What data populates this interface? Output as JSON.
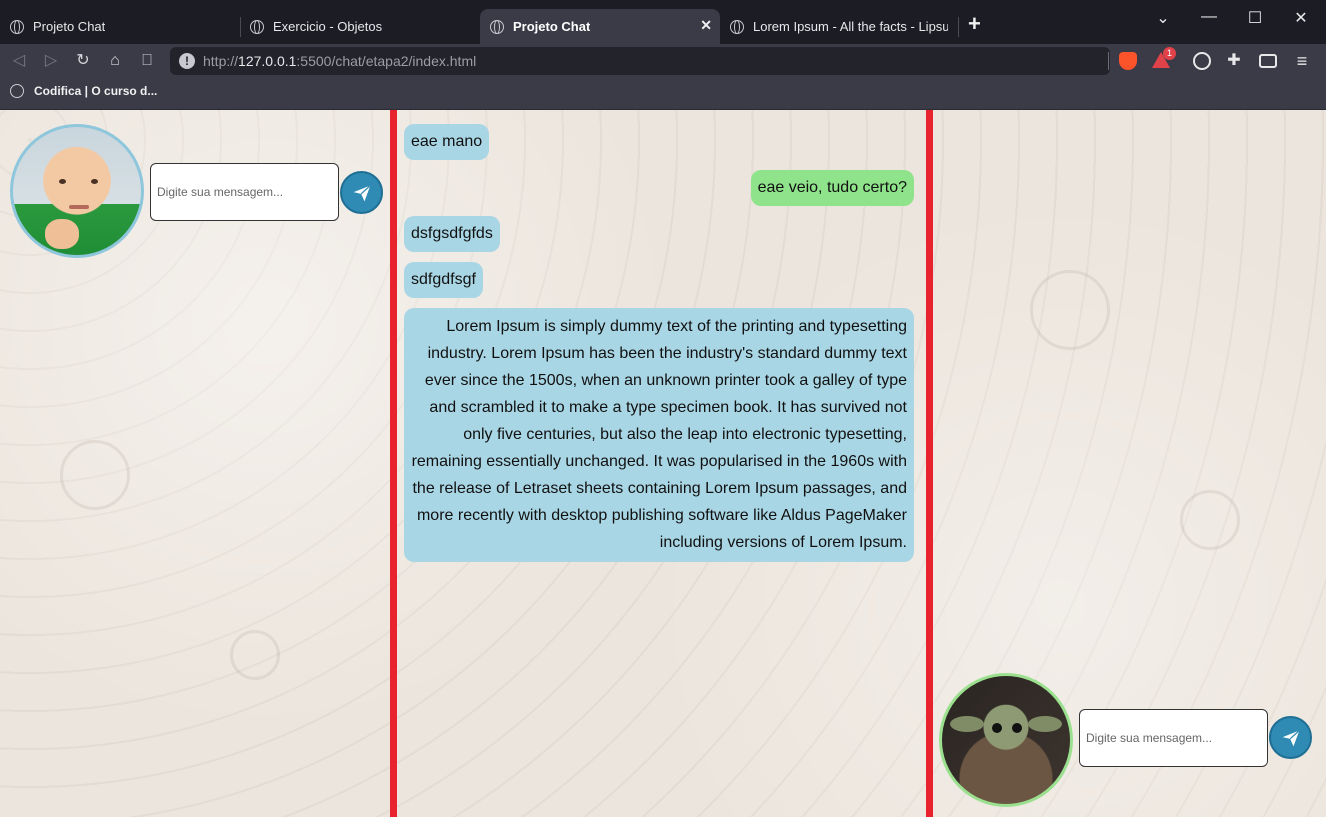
{
  "browser": {
    "tabs": [
      {
        "title": "Projeto Chat",
        "active": false
      },
      {
        "title": "Exercicio - Objetos",
        "active": false
      },
      {
        "title": "Projeto Chat",
        "active": true
      },
      {
        "title": "Lorem Ipsum - All the facts - Lipsum g",
        "active": false
      }
    ],
    "new_tab_label": "+",
    "close_label": "✕",
    "window_controls": {
      "dropdown": "⌄",
      "minimize": "—",
      "maximize": "☐",
      "close": "✕"
    },
    "url": {
      "scheme": "http://",
      "host": "127.0.0.1",
      "rest": ":5500/chat/etapa2/index.html"
    },
    "rewards_badge": "1",
    "bookmarks": [
      {
        "label": "Codifica | O curso d..."
      }
    ]
  },
  "page": {
    "user_a": {
      "input_placeholder": "Digite sua mensagem...",
      "accent": "#8ec6dc"
    },
    "user_b": {
      "input_placeholder": "Digite sua mensagem...",
      "accent": "#9be08f"
    },
    "chat_border_color": "#e8232e",
    "messages": [
      {
        "from": "a",
        "text": "eae mano"
      },
      {
        "from": "b",
        "text": "eae veio, tudo certo?"
      },
      {
        "from": "a",
        "text": "dsfgsdfgfds"
      },
      {
        "from": "a",
        "text": "sdfgdfsgf"
      },
      {
        "from": "a",
        "text": "Lorem Ipsum is simply dummy text of the printing and typesetting industry. Lorem Ipsum has been the industry's standard dummy text ever since the 1500s, when an unknown printer took a galley of type and scrambled it to make a type specimen book. It has survived not only five centuries, but also the leap into electronic typesetting, remaining essentially unchanged. It was popularised in the 1960s with the release of Letraset sheets containing Lorem Ipsum passages, and more recently with desktop publishing software like Aldus PageMaker including versions of Lorem Ipsum."
      }
    ]
  },
  "colors": {
    "bubble_in": "#a9d6e5",
    "bubble_out": "#8fe48b",
    "send_button": "#2f8bb4"
  },
  "icons": [
    "globe-icon",
    "back-icon",
    "forward-icon",
    "reload-icon",
    "home-icon",
    "bookmark-icon",
    "info-icon",
    "brave-icon",
    "rewards-icon",
    "lens-icon",
    "extensions-icon",
    "wallet-icon",
    "menu-icon",
    "send-icon"
  ]
}
